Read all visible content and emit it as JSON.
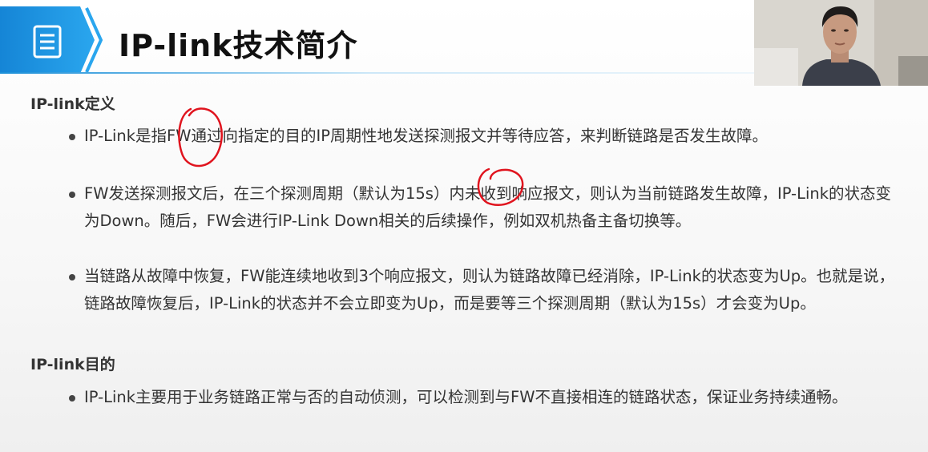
{
  "header": {
    "title": "IP-link技术简介",
    "icon": "document-icon",
    "accent_color": "#1a8fd8"
  },
  "sections": [
    {
      "heading": "IP-link定义",
      "bullets": [
        "IP-Link是指FW通过向指定的目的IP周期性地发送探测报文并等待应答，来判断链路是否发生故障。",
        "FW发送探测报文后，在三个探测周期（默认为15s）内未收到响应报文，则认为当前链路发生故障，IP-Link的状态变为Down。随后，FW会进行IP-Link Down相关的后续操作，例如双机热备主备切换等。",
        "当链路从故障中恢复，FW能连续地收到3个响应报文，则认为链路故障已经消除，IP-Link的状态变为Up。也就是说，链路故障恢复后，IP-Link的状态并不会立即变为Up，而是要等三个探测周期（默认为15s）才会变为Up。"
      ]
    },
    {
      "heading": "IP-link目的",
      "bullets": [
        "IP-Link主要用于业务链路正常与否的自动侦测，可以检测到与FW不直接相连的链路状态，保证业务持续通畅。"
      ]
    }
  ],
  "annotation_color": "#e0141e"
}
